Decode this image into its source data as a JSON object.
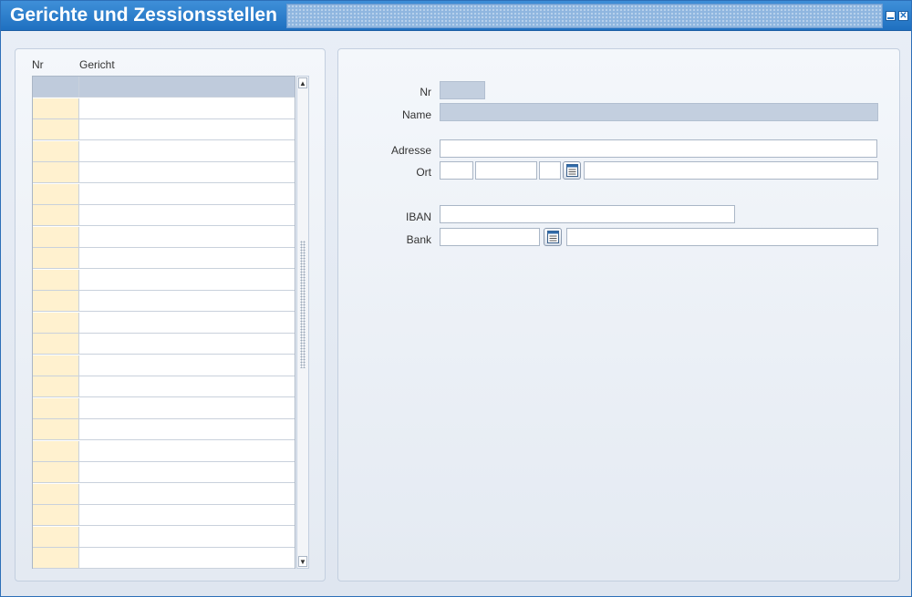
{
  "window": {
    "title": "Gerichte und Zessionsstellen",
    "minimize_icon": "minimize-icon",
    "close_icon": "close-icon",
    "close_glyph": "✕"
  },
  "list": {
    "columns": [
      "Nr",
      "Gericht"
    ],
    "rows": [
      {
        "nr": "",
        "gericht": ""
      },
      {
        "nr": "",
        "gericht": ""
      },
      {
        "nr": "",
        "gericht": ""
      },
      {
        "nr": "",
        "gericht": ""
      },
      {
        "nr": "",
        "gericht": ""
      },
      {
        "nr": "",
        "gericht": ""
      },
      {
        "nr": "",
        "gericht": ""
      },
      {
        "nr": "",
        "gericht": ""
      },
      {
        "nr": "",
        "gericht": ""
      },
      {
        "nr": "",
        "gericht": ""
      },
      {
        "nr": "",
        "gericht": ""
      },
      {
        "nr": "",
        "gericht": ""
      },
      {
        "nr": "",
        "gericht": ""
      },
      {
        "nr": "",
        "gericht": ""
      },
      {
        "nr": "",
        "gericht": ""
      },
      {
        "nr": "",
        "gericht": ""
      },
      {
        "nr": "",
        "gericht": ""
      },
      {
        "nr": "",
        "gericht": ""
      },
      {
        "nr": "",
        "gericht": ""
      },
      {
        "nr": "",
        "gericht": ""
      },
      {
        "nr": "",
        "gericht": ""
      },
      {
        "nr": "",
        "gericht": ""
      },
      {
        "nr": "",
        "gericht": ""
      }
    ],
    "selected_index": 0,
    "scroll_up_glyph": "▲",
    "scroll_down_glyph": "▼"
  },
  "form": {
    "nr": {
      "label": "Nr",
      "value": ""
    },
    "name": {
      "label": "Name",
      "value": ""
    },
    "adresse": {
      "label": "Adresse",
      "value": ""
    },
    "ort": {
      "label": "Ort",
      "country": "",
      "plz": "",
      "extra": "",
      "city": "",
      "lookup_icon": "lookup-list-icon"
    },
    "iban": {
      "label": "IBAN",
      "value": ""
    },
    "bank": {
      "label": "Bank",
      "code": "",
      "name": "",
      "lookup_icon": "lookup-list-icon"
    }
  },
  "colors": {
    "title_bar": "#1f70c0",
    "nr_column": "#fff1cf",
    "selected_row": "#bfcbdc",
    "readonly_field": "#c3cfdf"
  }
}
